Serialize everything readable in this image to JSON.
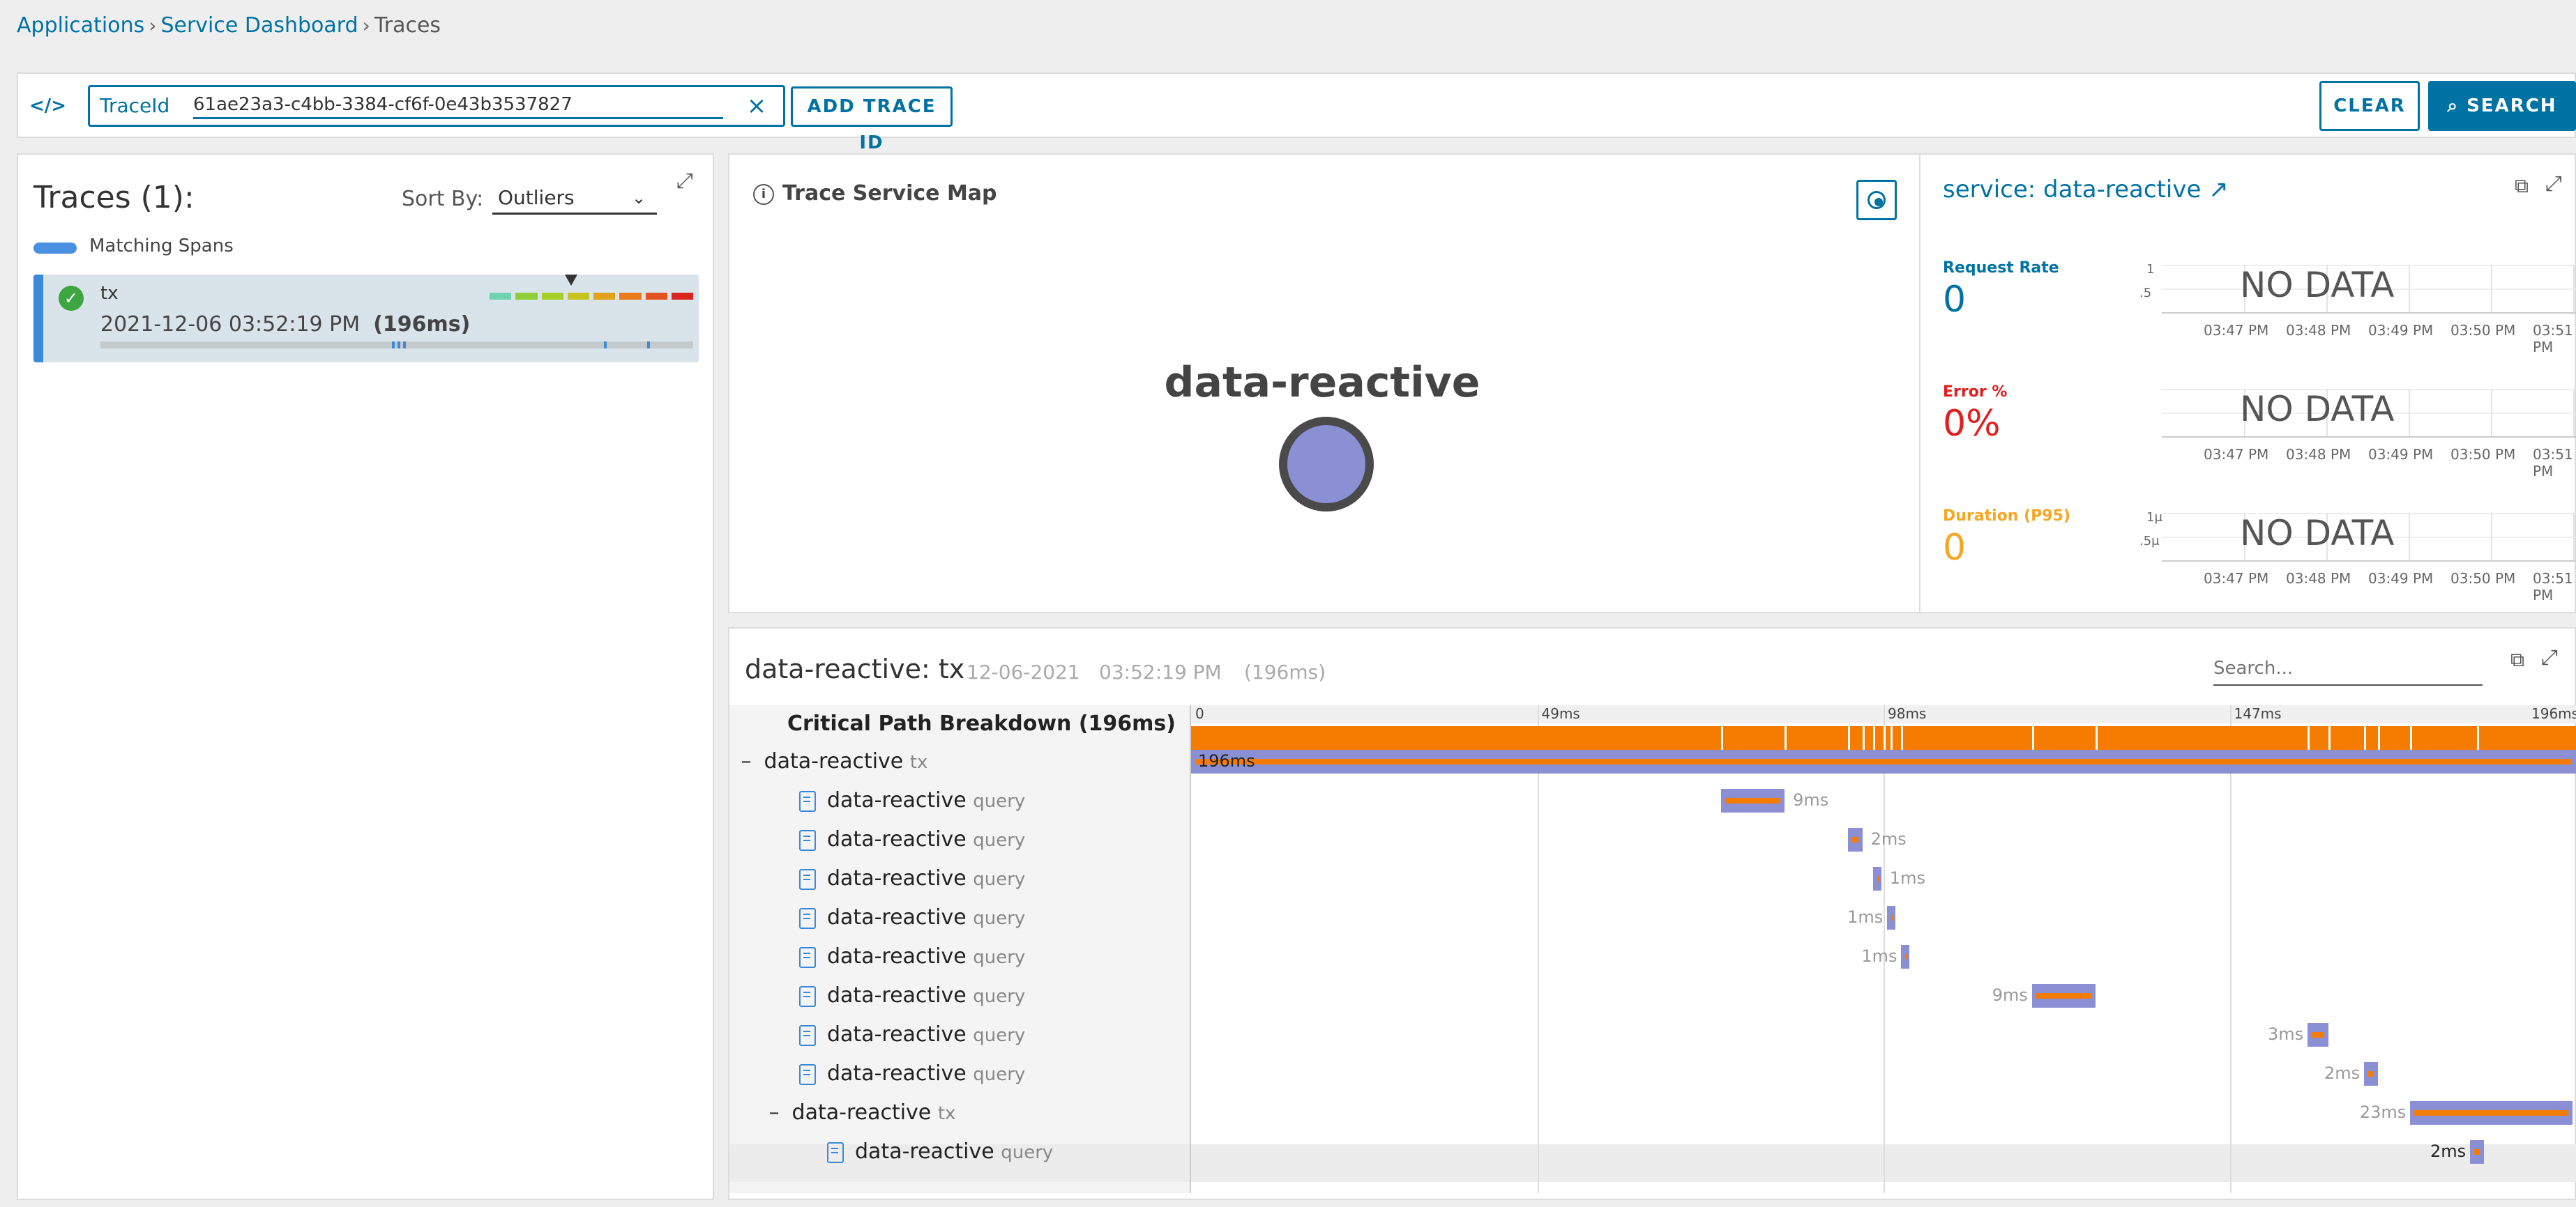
{
  "breadcrumb": {
    "items": [
      "Applications",
      "Service Dashboard"
    ],
    "current": "Traces",
    "separator": "›"
  },
  "toolbar": {
    "code_icon": "</>",
    "field_label": "TraceId",
    "trace_id_value": "61ae23a3-c4bb-3384-cf6f-0e43b3537827",
    "clear_icon": "×",
    "add_trace_label": "ADD TRACE ID",
    "clear_label": "CLEAR",
    "search_label": "SEARCH",
    "search_icon": "⌕"
  },
  "traces_panel": {
    "title": "Traces (1):",
    "sort_label": "Sort By:",
    "sort_value": "Outliers",
    "legend_label": "Matching Spans",
    "legend_color": "#4a90e2",
    "trace": {
      "name": "tx",
      "timestamp": "2021-12-06 03:52:19 PM",
      "duration": "(196ms)",
      "status": "success",
      "scale_colors": [
        "#6fd3b2",
        "#8fce3a",
        "#a6cf2a",
        "#c6c21e",
        "#e0a21a",
        "#ea7b1c",
        "#e4521f",
        "#d9261f"
      ]
    }
  },
  "service_map": {
    "title": "Trace Service Map",
    "info_icon": "i",
    "node_label": "data-reactive"
  },
  "service_panel": {
    "title": "service: data-reactive",
    "external_link_icon": "↗",
    "metrics": [
      {
        "label": "Request Rate",
        "value": "0",
        "color": "#0072a3",
        "y_ticks": [
          "1",
          ".5"
        ],
        "no_data": "NO DATA"
      },
      {
        "label": "Error %",
        "value": "0%",
        "color": "#e02020",
        "y_ticks": [],
        "no_data": "NO DATA"
      },
      {
        "label": "Duration (P95)",
        "value": "0",
        "color": "#f5a623",
        "y_ticks": [
          "1μ",
          ".5μ"
        ],
        "no_data": "NO DATA"
      }
    ],
    "x_ticks": [
      "03:47 PM",
      "03:48 PM",
      "03:49 PM",
      "03:50 PM",
      "03:51 PM"
    ]
  },
  "trace_detail": {
    "title": "data-reactive: tx",
    "date": "12-06-2021",
    "time": "03:52:19 PM",
    "duration": "(196ms)",
    "search_placeholder": "Search...",
    "critical_path_label": "Critical Path Breakdown (196ms)",
    "axis_labels": [
      "0",
      "49ms",
      "98ms",
      "147ms",
      "196ms"
    ],
    "rows": [
      {
        "name": "data-reactive",
        "kind": "tx",
        "toggle": "–",
        "indent": 0,
        "is_query": false
      },
      {
        "name": "data-reactive",
        "kind": "query",
        "toggle": "",
        "indent": 1,
        "is_query": true
      },
      {
        "name": "data-reactive",
        "kind": "query",
        "toggle": "",
        "indent": 1,
        "is_query": true
      },
      {
        "name": "data-reactive",
        "kind": "query",
        "toggle": "",
        "indent": 1,
        "is_query": true
      },
      {
        "name": "data-reactive",
        "kind": "query",
        "toggle": "",
        "indent": 1,
        "is_query": true
      },
      {
        "name": "data-reactive",
        "kind": "query",
        "toggle": "",
        "indent": 1,
        "is_query": true
      },
      {
        "name": "data-reactive",
        "kind": "query",
        "toggle": "",
        "indent": 1,
        "is_query": true
      },
      {
        "name": "data-reactive",
        "kind": "query",
        "toggle": "",
        "indent": 1,
        "is_query": true
      },
      {
        "name": "data-reactive",
        "kind": "query",
        "toggle": "",
        "indent": 1,
        "is_query": true
      },
      {
        "name": "data-reactive",
        "kind": "tx",
        "toggle": "–",
        "indent": 1,
        "is_query": false
      },
      {
        "name": "data-reactive",
        "kind": "query",
        "toggle": "",
        "indent": 2,
        "is_query": true
      }
    ],
    "spans": [
      {
        "start_ms": 0,
        "dur_ms": 196,
        "label": "196ms",
        "label_pos": "inside"
      },
      {
        "start_ms": 75,
        "dur_ms": 9,
        "label": "9ms",
        "label_pos": "right"
      },
      {
        "start_ms": 93,
        "dur_ms": 2,
        "label": "2ms",
        "label_pos": "right"
      },
      {
        "start_ms": 96.5,
        "dur_ms": 1,
        "label": "1ms",
        "label_pos": "right"
      },
      {
        "start_ms": 98.5,
        "dur_ms": 1,
        "label": "1ms",
        "label_pos": "left"
      },
      {
        "start_ms": 100.5,
        "dur_ms": 1,
        "label": "1ms",
        "label_pos": "left"
      },
      {
        "start_ms": 119,
        "dur_ms": 9,
        "label": "9ms",
        "label_pos": "left"
      },
      {
        "start_ms": 158,
        "dur_ms": 3,
        "label": "3ms",
        "label_pos": "left"
      },
      {
        "start_ms": 166,
        "dur_ms": 2,
        "label": "2ms",
        "label_pos": "left"
      },
      {
        "start_ms": 172.5,
        "dur_ms": 23,
        "label": "23ms",
        "label_pos": "left"
      },
      {
        "start_ms": 181,
        "dur_ms": 2,
        "label": "2ms",
        "label_pos": "left"
      }
    ]
  }
}
